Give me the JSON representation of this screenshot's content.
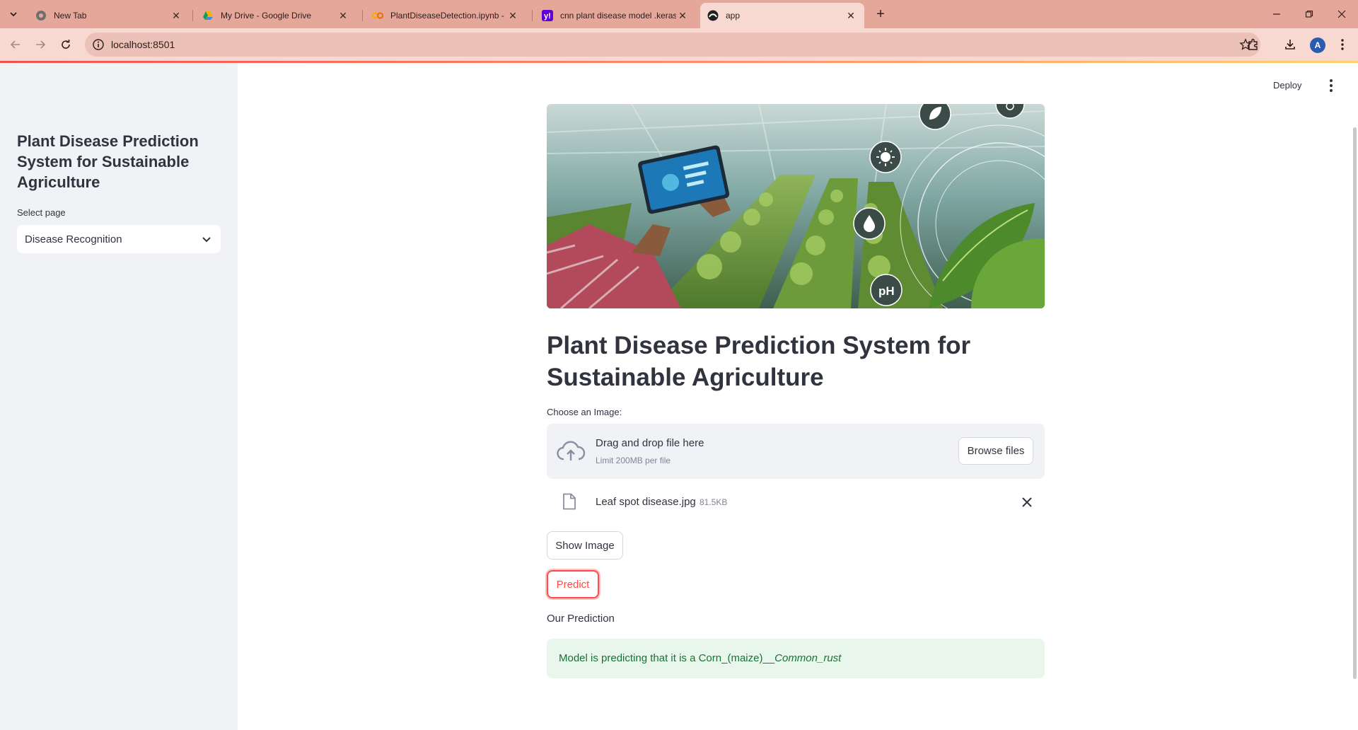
{
  "browser": {
    "tabs": [
      {
        "title": "New Tab",
        "icon": "chrome-icon"
      },
      {
        "title": "My Drive - Google Drive",
        "icon": "google-drive-icon"
      },
      {
        "title": "PlantDiseaseDetection.ipynb - C",
        "icon": "colab-icon"
      },
      {
        "title": "cnn plant disease model .keras",
        "icon": "yahoo-icon"
      },
      {
        "title": "app",
        "icon": "streamlit-icon",
        "active": true
      }
    ],
    "url": "localhost:8501",
    "profile_initial": "A",
    "accent_color": "#e6a79b"
  },
  "sidebar": {
    "title": "Plant Disease Prediction System for Sustainable Agriculture",
    "select_label": "Select page",
    "select_value": "Disease Recognition"
  },
  "header": {
    "deploy_label": "Deploy"
  },
  "main": {
    "title": "Plant Disease Prediction System for Sustainable Agriculture",
    "uploader": {
      "label": "Choose an Image:",
      "drop_text": "Drag and drop file here",
      "limit_text": "Limit 200MB per file",
      "browse_label": "Browse files"
    },
    "file": {
      "name": "Leaf spot disease.jpg",
      "size": "81.5KB"
    },
    "show_image_label": "Show Image",
    "predict_label": "Predict",
    "prediction_heading": "Our Prediction",
    "prediction": {
      "prefix": "Model is predicting that it is a Corn_(maize)__",
      "italic": "Common_rust"
    },
    "hero_icons": [
      "leaf-icon",
      "sun-icon",
      "water-drop-icon",
      "ph-icon"
    ],
    "hero_ph_text": "pH"
  },
  "colors": {
    "primary": "#ff4b4b",
    "success_bg": "#e9f6ec",
    "success_text": "#177233",
    "sidebar_bg": "#f0f2f6"
  }
}
